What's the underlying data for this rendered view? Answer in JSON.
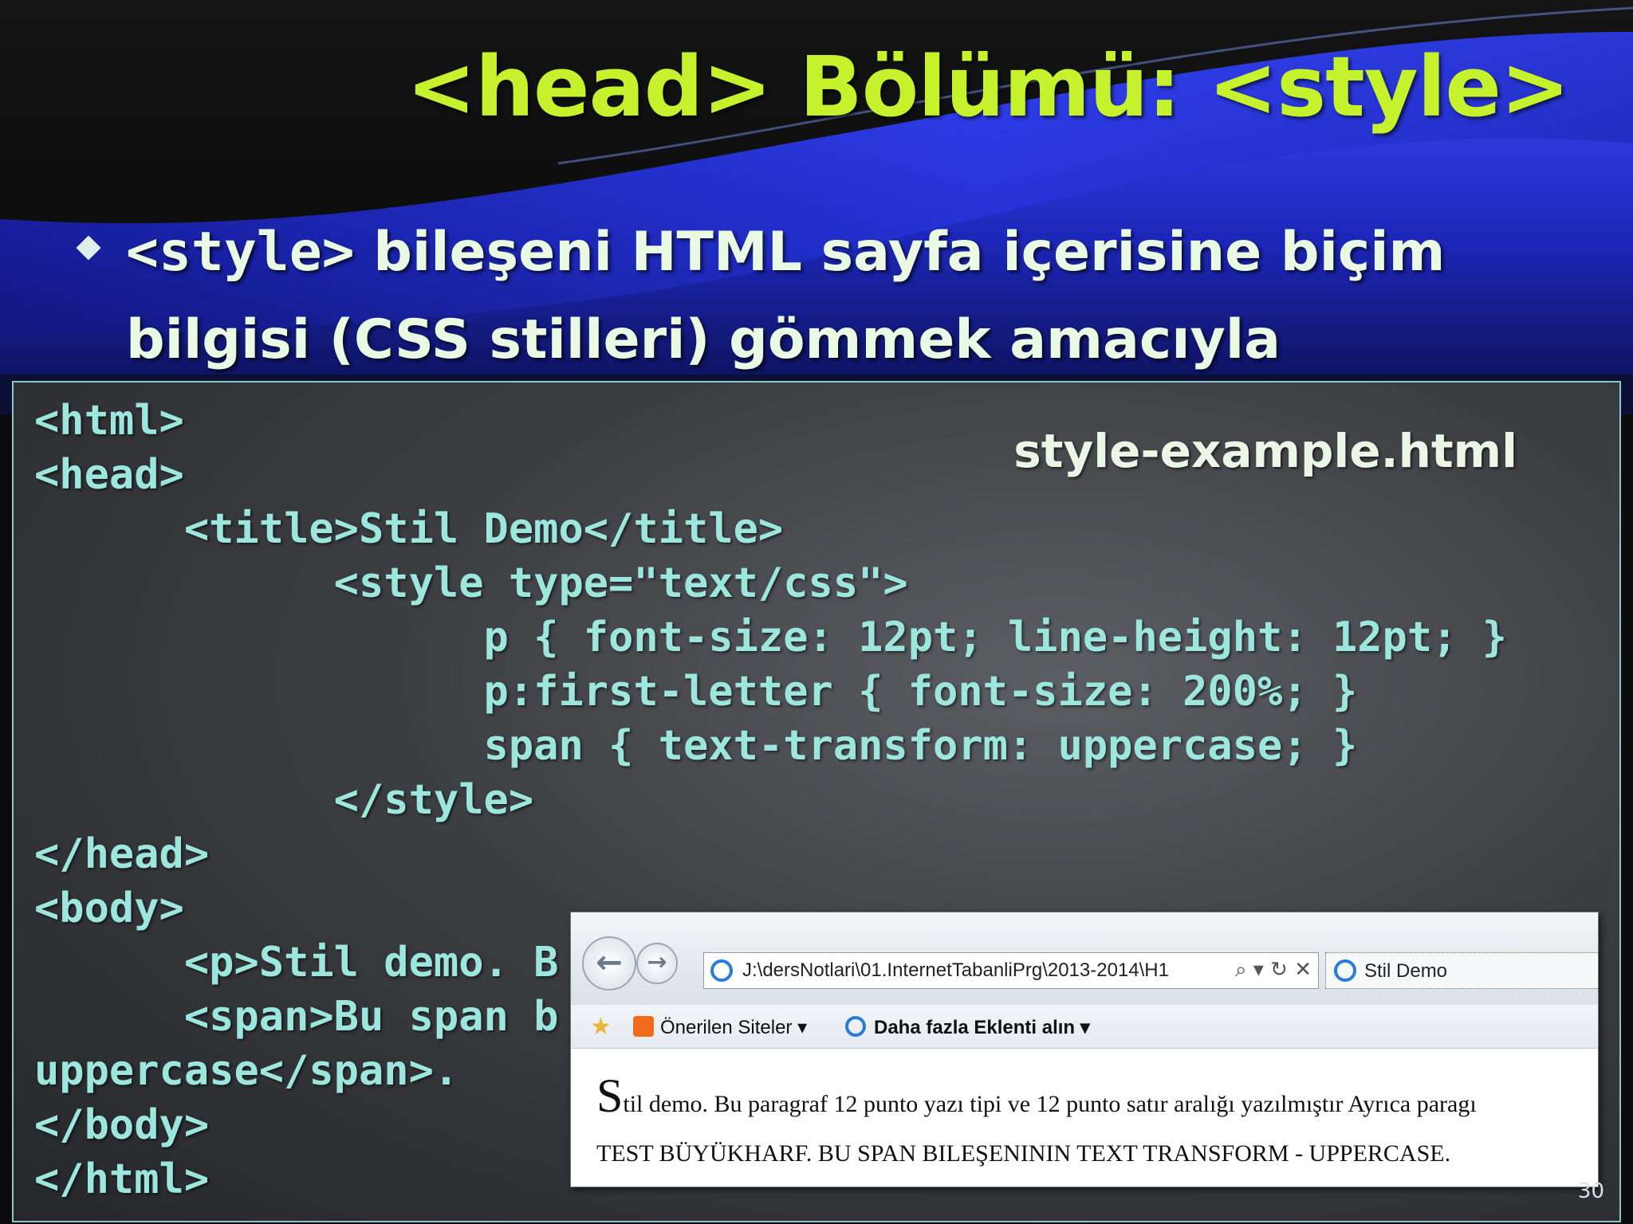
{
  "slide": {
    "title": "<head> Bölümü: <style>",
    "bullet_code": "<style>",
    "bullet_line1": " bileşeni HTML sayfa içerisine biçim",
    "bullet_line2": "bilgisi (CSS stilleri) gömmek amacıyla kullanılır.",
    "filename": "style-example.html",
    "page_number": "30"
  },
  "code_lines": [
    "<html>",
    "<head>",
    "      <title>Stil Demo</title>",
    "            <style type=\"text/css\">",
    "                  p { font-size: 12pt; line-height: 12pt; }",
    "                  p:first-letter { font-size: 200%; }",
    "                  span { text-transform: uppercase; }",
    "            </style>",
    "</head>",
    "<body>",
    "      <p>Stil demo. B",
    "      <span>Bu span b",
    "uppercase</span>.",
    "</body>",
    "</html>"
  ],
  "browser": {
    "address": "J:\\dersNotlari\\01.InternetTabanliPrg\\2013-2014\\H1",
    "address_tools": "⌕ ▾ ↻ ✕",
    "tab_title": "Stil Demo",
    "favorites": {
      "suggested_sites": "Önerilen Siteler ▾",
      "more_addons": "Daha fazla Eklenti alın ▾"
    },
    "page": {
      "para_first_letter": "S",
      "para_rest": "til demo. Bu paragraf 12 punto yazı tipi ve 12 punto satır aralığı yazılmıştır Ayrıca paragı",
      "span_text": "TEST BÜYÜKHARF. BU SPAN BILEŞENININ TEXT TRANSFORM - UPPERCASE."
    }
  },
  "colors": {
    "title": "#c6f12d",
    "code": "#9de6de",
    "bullet_text": "#eaf9e4",
    "wave_blue": "#2233d8"
  }
}
